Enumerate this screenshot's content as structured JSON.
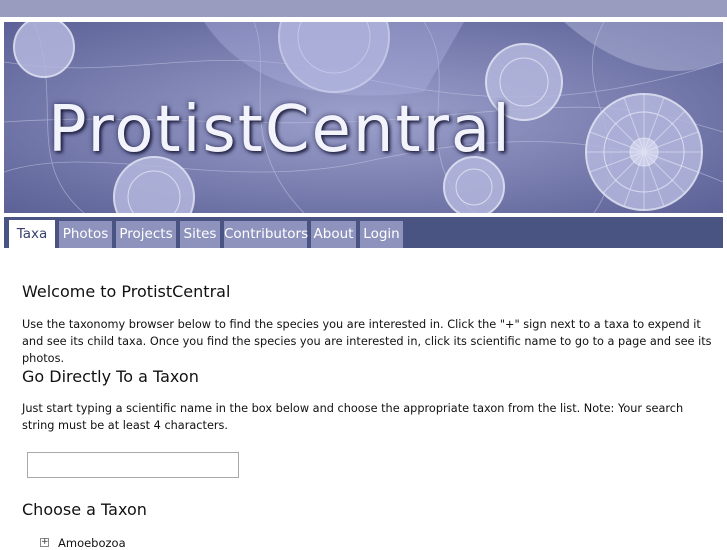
{
  "site": {
    "title": "ProtistCentral"
  },
  "nav": {
    "tabs": [
      {
        "label": "Taxa",
        "active": true
      },
      {
        "label": "Photos",
        "active": false
      },
      {
        "label": "Projects",
        "active": false
      },
      {
        "label": "Sites",
        "active": false
      },
      {
        "label": "Contributors",
        "active": false
      },
      {
        "label": "About",
        "active": false
      },
      {
        "label": "Login",
        "active": false
      }
    ]
  },
  "main": {
    "welcome_heading": "Welcome to ProtistCentral",
    "welcome_text": "Use the taxonomy browser below to find the species you are interested in. Click the \"+\" sign next to a taxa to expend it and see its child taxa. Once you find the species you are interested in, click its scientific name to go to a page and see its photos.",
    "direct_heading": "Go Directly To a Taxon",
    "direct_text": "Just start typing a scientific name in the box below and choose the appropriate taxon from the list. Note: Your search string must be at least 4 characters.",
    "search": {
      "value": "",
      "placeholder": ""
    },
    "choose_heading": "Choose a Taxon",
    "tree": [
      {
        "label": "Amoebozoa",
        "expander": "+"
      }
    ]
  },
  "colors": {
    "topbar": "#9a9cbf",
    "navbar": "#4a5483",
    "tab_inactive": "#8e93bd",
    "banner": "#7f84b6"
  }
}
